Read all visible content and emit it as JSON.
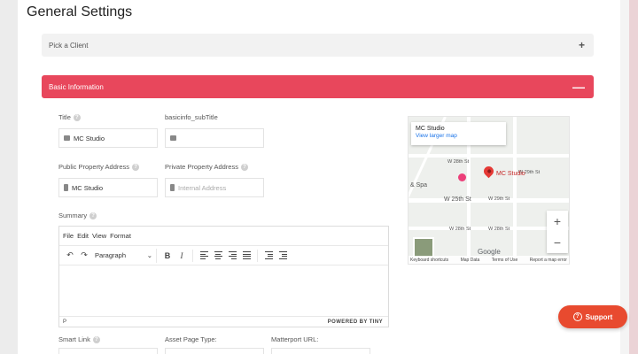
{
  "page": {
    "title": "General Settings"
  },
  "accordions": [
    {
      "label": "Pick a Client",
      "toggle": "+"
    },
    {
      "label": "Basic Information",
      "toggle": "—"
    }
  ],
  "fields": {
    "title": {
      "label": "Title",
      "value": "MC Studio"
    },
    "subtitle": {
      "label": "basicinfo_subTitle",
      "value": ""
    },
    "public_address": {
      "label": "Public Property Address",
      "value": "MC Studio"
    },
    "private_address": {
      "label": "Private Property Address",
      "placeholder": "Internal Address"
    },
    "summary": {
      "label": "Summary"
    },
    "smart_link": {
      "label": "Smart Link"
    },
    "asset_page_type": {
      "label": "Asset Page Type:"
    },
    "matterport_url": {
      "label": "Matterport URL:"
    }
  },
  "editor": {
    "menu": [
      "File",
      "Edit",
      "View",
      "Format"
    ],
    "block_format": "Paragraph",
    "status_path": "P",
    "powered_by": "POWERED BY TINY"
  },
  "map": {
    "place_name": "MC Studio",
    "view_larger": "View larger map",
    "pin_label": "MC Studio",
    "poi_label": "& Spa",
    "streets": [
      "W 28th St",
      "W 29th St",
      "W 29th St",
      "W 25th St",
      "W 28th St",
      "W 28th St"
    ],
    "zoom_in": "+",
    "zoom_out": "−",
    "google": "Google",
    "attribution": [
      "Keyboard shortcuts",
      "Map Data",
      "Terms of Use",
      "Report a map error"
    ]
  },
  "support": {
    "label": "Support"
  },
  "colors": {
    "accent": "#e8475c",
    "support": "#e84a2f"
  }
}
